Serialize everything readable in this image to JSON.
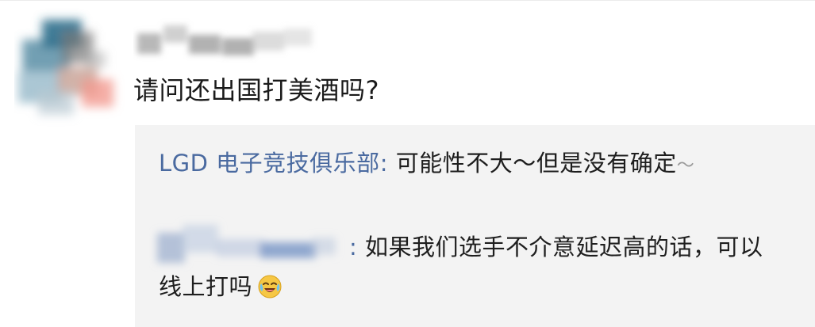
{
  "comment": {
    "text": "请问还出国打美酒吗?"
  },
  "replies": [
    {
      "author": "LGD 电子竞技俱乐部",
      "separator": ": ",
      "text": "可能性不大～但是没有确定",
      "tilde": "～"
    },
    {
      "author_visible_fragment": "",
      "separator": ": ",
      "text": "如果我们选手不介意延迟高的话，可以线上打吗",
      "emoji_icon": "laughing-crying-emoji"
    }
  ],
  "colors": {
    "author_link": "#4a6aa0",
    "reply_background": "#f3f3f3",
    "body_text": "#1a1a1a"
  }
}
